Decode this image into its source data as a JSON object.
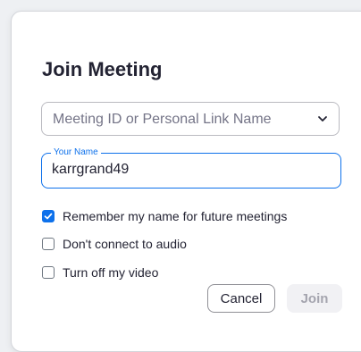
{
  "dialog": {
    "title": "Join Meeting",
    "meeting_select": {
      "placeholder": "Meeting ID or Personal Link Name",
      "icon": "chevron-down-icon"
    },
    "name_field": {
      "legend": "Your Name",
      "value": "karrgrand49"
    },
    "options": [
      {
        "label": "Remember my name for future meetings",
        "checked": true
      },
      {
        "label": "Don't connect to audio",
        "checked": false
      },
      {
        "label": "Turn off my video",
        "checked": false
      }
    ],
    "buttons": {
      "cancel": "Cancel",
      "join": "Join"
    }
  },
  "colors": {
    "accent": "#0e71eb",
    "text": "#232333",
    "placeholder": "#747487",
    "disabled_bg": "#f1f1f4",
    "disabled_text": "#a4a4ae"
  }
}
